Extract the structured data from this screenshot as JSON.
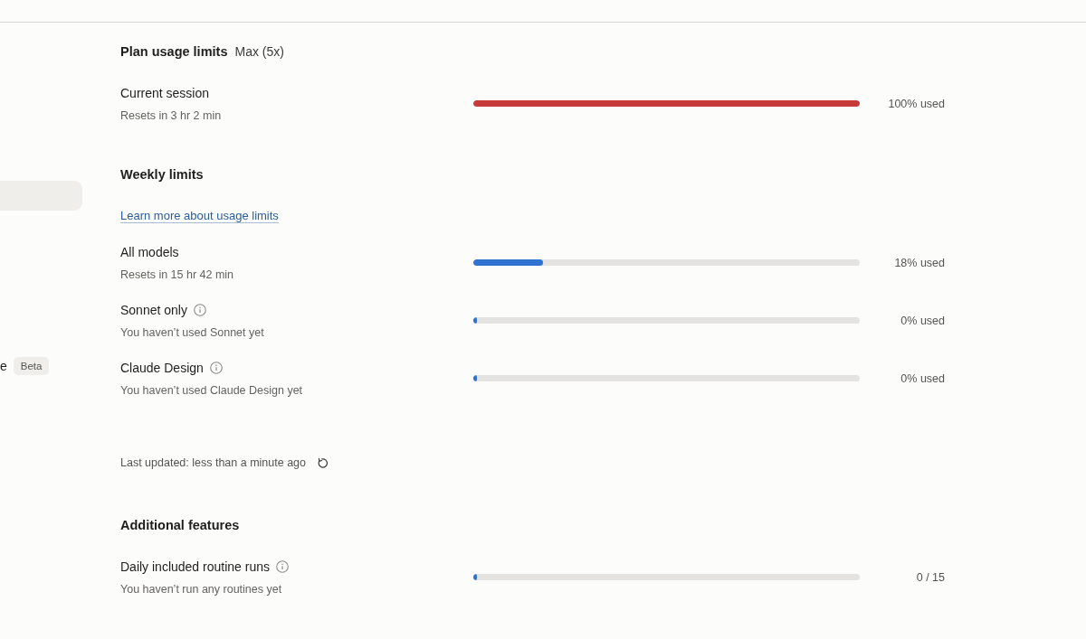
{
  "sidebar": {
    "items": [
      {
        "selected": true
      },
      {
        "label": "e",
        "badge": "Beta",
        "selected": false
      }
    ]
  },
  "sections": [
    {
      "title": "Plan usage limits",
      "plan": "Max (5x)",
      "limits": [
        {
          "label": "Current session",
          "info": false,
          "detail": "Resets in 3 hr 2 min",
          "level": 1,
          "reading": "100% used"
        }
      ]
    },
    {
      "title": "Weekly limits",
      "link": "Learn more about usage limits",
      "limits": [
        {
          "label": "All models",
          "info": false,
          "detail": "Resets in 15 hr 42 min",
          "level": 0.18,
          "reading": "18% used"
        },
        {
          "label": "Sonnet only",
          "info": true,
          "detail": "You haven’t used Sonnet yet",
          "level": 0,
          "reading": "0% used"
        },
        {
          "label": "Claude Design",
          "info": true,
          "detail": "You haven’t used Claude Design yet",
          "level": 0,
          "reading": "0% used"
        }
      ],
      "footer": "Last updated: less than a minute ago"
    },
    {
      "title": "Additional features",
      "limits": [
        {
          "label": "Daily included routine runs",
          "info": true,
          "detail": "You haven’t run any routines yet",
          "level": 0,
          "reading": "0 / 15"
        }
      ]
    }
  ]
}
